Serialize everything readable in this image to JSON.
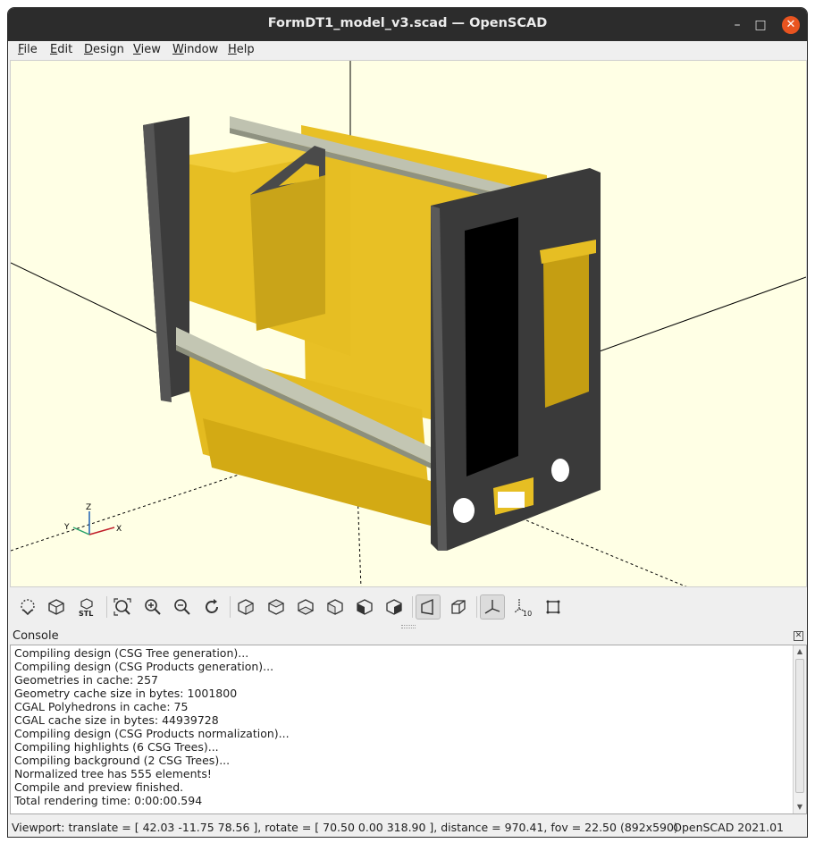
{
  "window": {
    "title": "FormDT1_model_v3.scad — OpenSCAD",
    "minimize_glyph": "–",
    "maximize_glyph": "□",
    "close_glyph": "✕"
  },
  "menubar": {
    "items": [
      {
        "underline": "F",
        "rest": "ile"
      },
      {
        "underline": "E",
        "rest": "dit"
      },
      {
        "underline": "D",
        "rest": "esign"
      },
      {
        "underline": "V",
        "rest": "iew"
      },
      {
        "underline": "W",
        "rest": "indow"
      },
      {
        "underline": "H",
        "rest": "elp"
      }
    ]
  },
  "viewport": {
    "background_color": "#ffffe5",
    "model_color": "#e6be23",
    "frame_color": "#3c3c3c",
    "axes_labels": {
      "x": "X",
      "y": "Y",
      "z": "Z"
    }
  },
  "toolbar": {
    "buttons": [
      {
        "name": "preview-render-button",
        "icon": "preview-icon",
        "active": false
      },
      {
        "name": "render-button",
        "icon": "render-icon",
        "active": false
      },
      {
        "name": "export-stl-button",
        "icon": "stl-icon",
        "label": "STL",
        "active": false
      },
      {
        "name": "view-all-button",
        "icon": "zoom-fit-icon",
        "active": false
      },
      {
        "name": "zoom-in-button",
        "icon": "zoom-in-icon",
        "active": false
      },
      {
        "name": "zoom-out-button",
        "icon": "zoom-out-icon",
        "active": false
      },
      {
        "name": "reset-view-button",
        "icon": "reset-view-icon",
        "active": false
      },
      {
        "name": "view-right-button",
        "icon": "view-right-icon",
        "active": false
      },
      {
        "name": "view-top-button",
        "icon": "view-top-icon",
        "active": false
      },
      {
        "name": "view-bottom-button",
        "icon": "view-bottom-icon",
        "active": false
      },
      {
        "name": "view-left-button",
        "icon": "view-left-icon",
        "active": false
      },
      {
        "name": "view-front-button",
        "icon": "view-front-icon",
        "active": false
      },
      {
        "name": "view-back-button",
        "icon": "view-back-icon",
        "active": false
      },
      {
        "name": "perspective-button",
        "icon": "perspective-icon",
        "active": true
      },
      {
        "name": "orthogonal-button",
        "icon": "orthogonal-icon",
        "active": false
      },
      {
        "name": "show-axes-button",
        "icon": "axes-icon",
        "active": true
      },
      {
        "name": "show-scale-markers-button",
        "icon": "scale-markers-icon",
        "label": "10",
        "active": false
      },
      {
        "name": "show-edges-button",
        "icon": "edges-icon",
        "active": false
      }
    ]
  },
  "console": {
    "title": "Console",
    "lines": [
      "Compiling design (CSG Tree generation)...",
      "Compiling design (CSG Products generation)...",
      "Geometries in cache: 257",
      "Geometry cache size in bytes: 1001800",
      "CGAL Polyhedrons in cache: 75",
      "CGAL cache size in bytes: 44939728",
      "Compiling design (CSG Products normalization)...",
      "Compiling highlights (6 CSG Trees)...",
      "Compiling background (2 CSG Trees)...",
      "Normalized tree has 555 elements!",
      "Compile and preview finished.",
      "Total rendering time: 0:00:00.594"
    ]
  },
  "statusbar": {
    "viewport_info": "Viewport: translate = [ 42.03 -11.75 78.56 ], rotate = [ 70.50 0.00 318.90 ], distance = 970.41, fov = 22.50 (892x590)",
    "version": "OpenSCAD 2021.01"
  }
}
